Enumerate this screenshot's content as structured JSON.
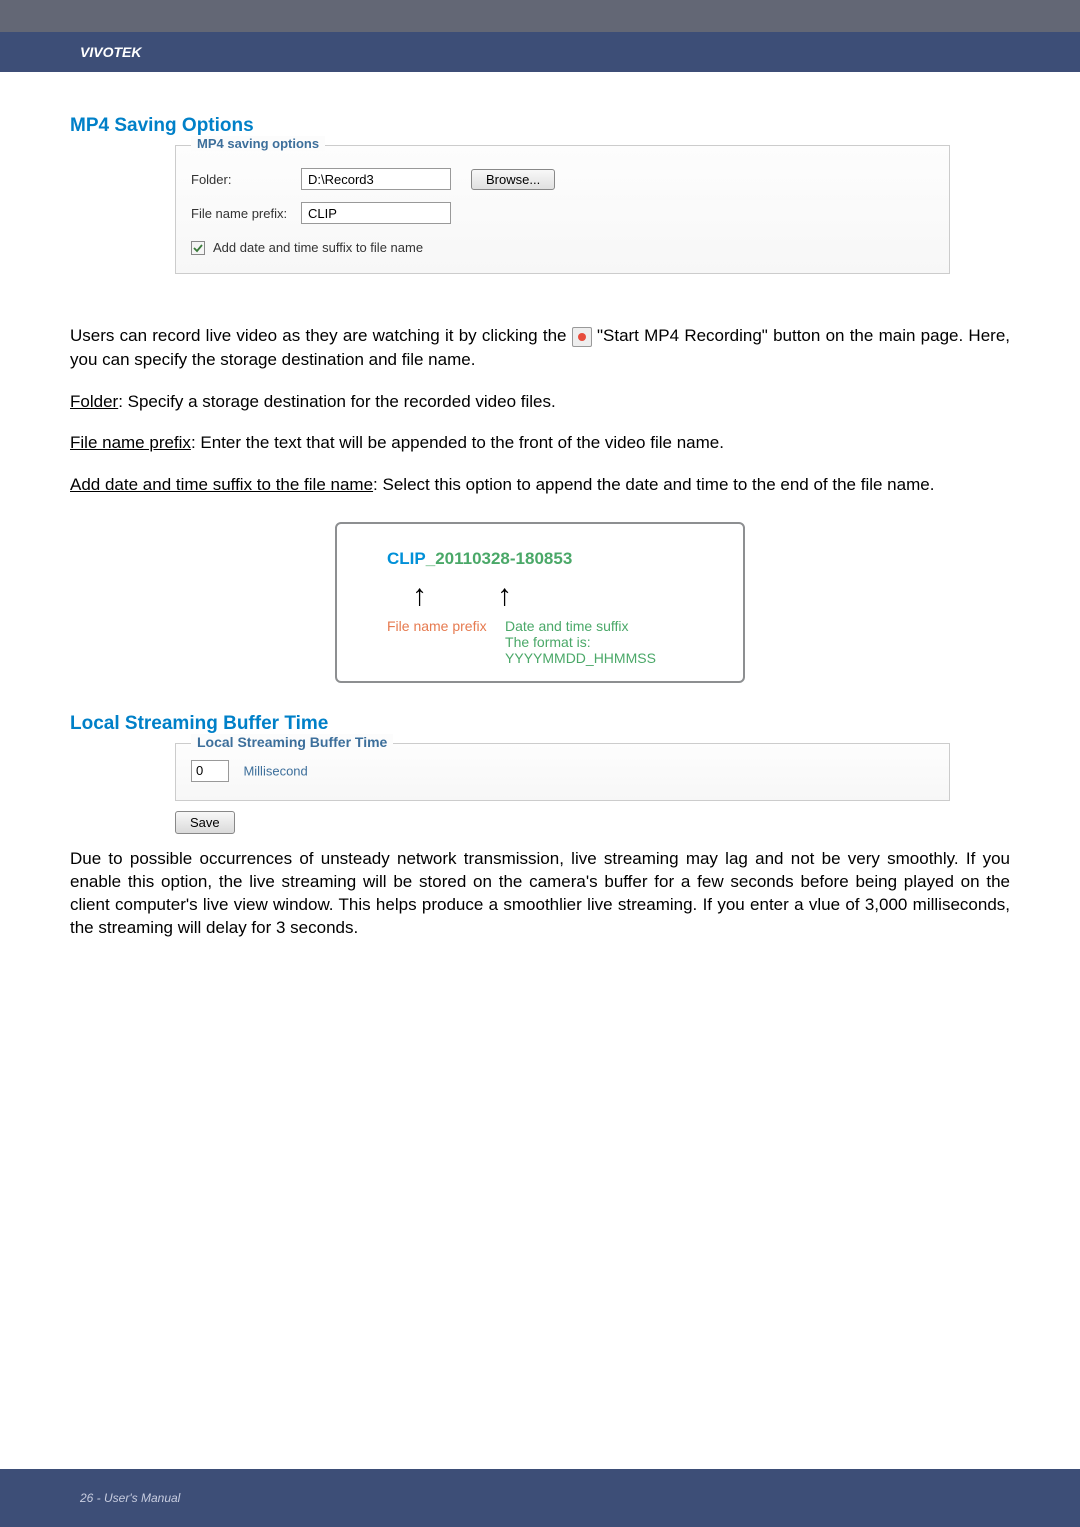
{
  "header": {
    "brand": "VIVOTEK"
  },
  "section1": {
    "title": "MP4 Saving Options",
    "fieldset_legend": "MP4 saving options",
    "folder_label": "Folder:",
    "folder_value": "D:\\Record3",
    "browse_label": "Browse...",
    "prefix_label": "File name prefix:",
    "prefix_value": "CLIP",
    "checkbox_label": "Add date and time suffix to file name"
  },
  "para1a": "Users can record live video as they are watching it by clicking the ",
  "para1b": " \"Start MP4 Recording\" button on the main page. Here, you can specify the storage destination and file name.",
  "para2a": "Folder",
  "para2b": ": Specify a storage destination for the recorded video files.",
  "para3a": "File name prefix",
  "para3b": ": Enter the text that will be appended to the front of the video file name.",
  "para4a": "Add date and time suffix to the file name",
  "para4b": ": Select this option to append the date and time to the end of the file name.",
  "illustration": {
    "clip_prefix": "CLIP",
    "clip_suffix": "_20110328-180853",
    "label1": "File name prefix",
    "label2a": "Date and time suffix",
    "label2b": "The format is: YYYYMMDD_HHMMSS"
  },
  "section2": {
    "title": "Local Streaming Buffer Time",
    "legend": "Local Streaming Buffer Time",
    "value": "0",
    "unit": "Millisecond",
    "save_label": "Save"
  },
  "para5": "Due to possible occurrences of unsteady network transmission, live streaming may lag and not be very smoothly. If you enable this option, the live streaming will be stored on the camera's buffer for a few seconds before being played on the client computer's live view window. This helps produce a smoothlier live streaming. If you enter a vlue of 3,000 milliseconds, the streaming will delay for 3 seconds.",
  "footer": {
    "text": "26 - User's Manual"
  }
}
